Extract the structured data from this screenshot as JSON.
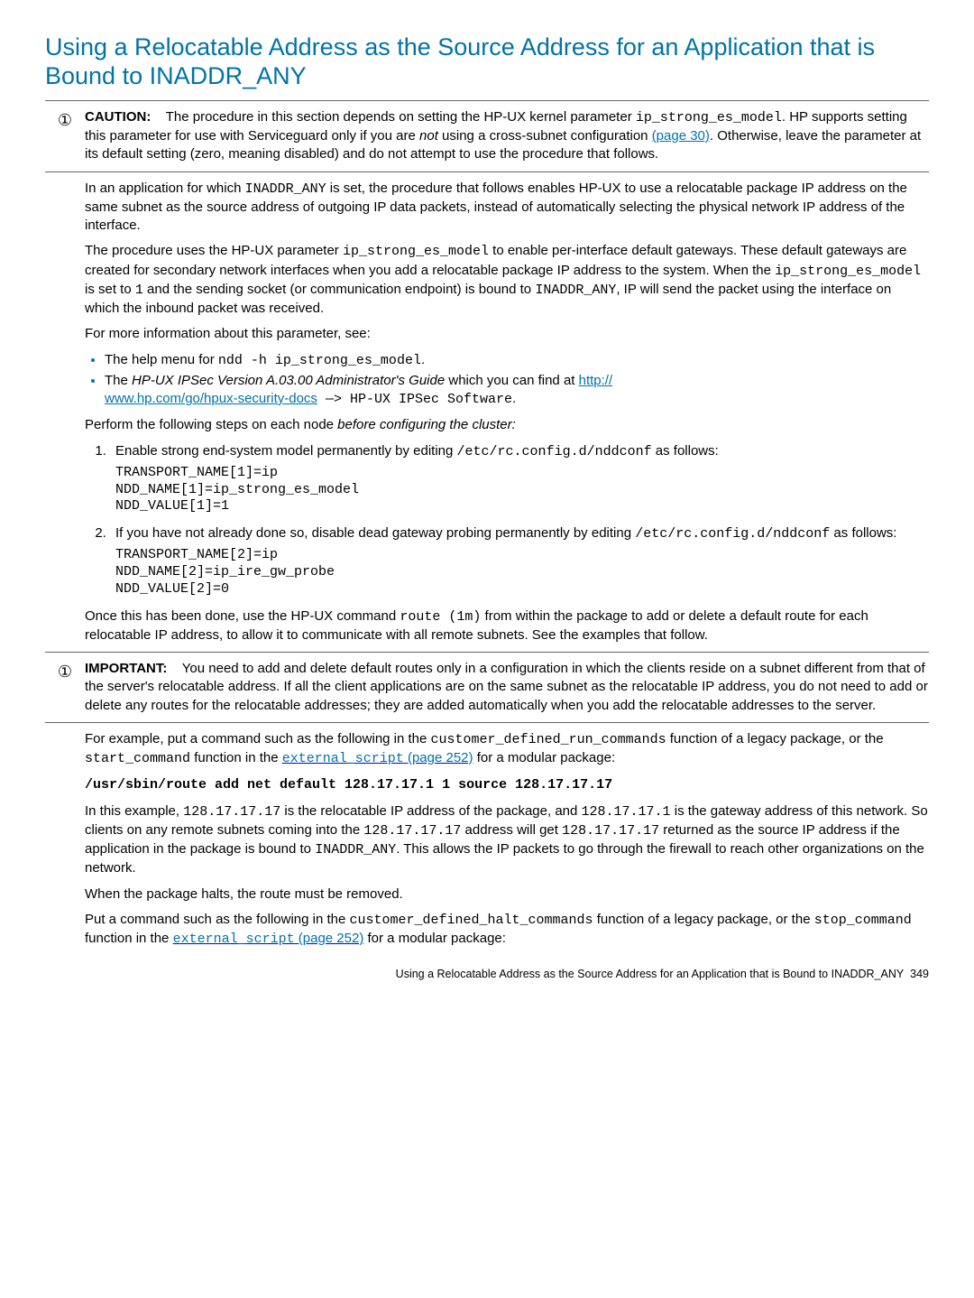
{
  "heading": "Using a Relocatable Address as the Source Address for an Application that is Bound to INADDR_ANY",
  "caution": {
    "icon": "①",
    "label": "CAUTION:",
    "t1": "The procedure in this section depends on setting the HP-UX kernel parameter ",
    "code1": "ip_strong_es_model",
    "t2": ". HP supports setting this parameter for use with Serviceguard only if you are ",
    "t2i": "not",
    "t3": " using a cross-subnet configuration ",
    "link1": "(page 30)",
    "t4": ". Otherwise, leave the parameter at its default setting (zero, meaning disabled) and do not attempt to use the procedure that follows."
  },
  "p1": {
    "a": "In an application for which ",
    "c": "INADDR_ANY",
    "b": " is set, the procedure that follows enables HP-UX to use a relocatable package IP address on the same subnet as the source address of outgoing IP data packets, instead of automatically selecting the physical network IP address of the interface."
  },
  "p2": {
    "a": "The procedure uses the HP-UX parameter ",
    "c1": "ip_strong_es_model",
    "b": " to enable per-interface default gateways. These default gateways are created for secondary network interfaces when you add a relocatable package IP address to the system. When the ",
    "c2": "ip_strong_es_model",
    "c": " is set to ",
    "c3": "1",
    "d": " and the sending socket (or communication endpoint) is bound to ",
    "c4": "INADDR_ANY",
    "e": ", IP will send the packet using the interface on which the inbound packet was received."
  },
  "p3": "For more information about this parameter, see:",
  "bul1_a": "The help menu for ",
  "bul1_c": "ndd -h ip_strong_es_model",
  "bul1_b": ".",
  "bul2_a": "The ",
  "bul2_i": "HP-UX IPSec Version A.03.00 Administrator's Guide",
  "bul2_b": " which you can find at ",
  "bul2_link1": "http://",
  "bul2_link2": "www.hp.com/go/hpux-security-docs",
  "bul2_c": " —> HP-UX IPSec Software",
  "bul2_d": ".",
  "p4_a": "Perform the following steps on each node ",
  "p4_i": "before configuring the cluster:",
  "step1_a": "Enable strong end-system model permanently by editing ",
  "step1_c": "/etc/rc.config.d/nddconf",
  "step1_b": " as follows:",
  "step1_code": "TRANSPORT_NAME[1]=ip\nNDD_NAME[1]=ip_strong_es_model\nNDD_VALUE[1]=1",
  "step2_a": "If you have not already done so, disable dead gateway probing permanently by editing ",
  "step2_c": "/etc/rc.config.d/nddconf",
  "step2_b": " as follows:",
  "step2_code": "TRANSPORT_NAME[2]=ip\nNDD_NAME[2]=ip_ire_gw_probe\nNDD_VALUE[2]=0",
  "p5_a": "Once this has been done, use the HP-UX command ",
  "p5_c": "route (1m)",
  "p5_b": " from within the package to add or delete a default route for each relocatable IP address, to allow it to communicate with all remote subnets. See the examples that follow.",
  "important": {
    "icon": "①",
    "label": "IMPORTANT:",
    "text": "You need to add and delete default routes only in a configuration in which the clients reside on a subnet different from that of the server's relocatable address. If all the client applications are on the same subnet as the relocatable IP address, you do not need to add or delete any routes for the relocatable addresses; they are added automatically when you add the relocatable addresses to the server."
  },
  "p6_a": "For example, put a command such as the following in the ",
  "p6_c1": "customer_defined_run_commands",
  "p6_b": " function of a legacy package, or the ",
  "p6_c2": "start_command",
  "p6_c": " function in the ",
  "p6_link": "external_script",
  "p6_page": " (page 252)",
  "p6_d": " for a modular package:",
  "cmdline": "/usr/sbin/route add net default 128.17.17.1 1 source 128.17.17.17",
  "p7_a": "In this example, ",
  "p7_c1": "128.17.17.17",
  "p7_b": " is the relocatable IP address of the package, and ",
  "p7_c2": "128.17.17.1",
  "p7_c": " is the gateway address of this network. So clients on any remote subnets coming into the ",
  "p7_c3": "128.17.17.17",
  "p7_d": " address will get ",
  "p7_c4": "128.17.17.17",
  "p7_e": " returned as the source IP address if the application in the package is bound to ",
  "p7_c5": "INADDR_ANY",
  "p7_f": ". This allows the IP packets to go through the firewall to reach other organizations on the network.",
  "p8": "When the package halts, the route must be removed.",
  "p9_a": "Put a command such as the following in the ",
  "p9_c1": "customer_defined_halt_commands",
  "p9_b": " function of a legacy package, or the ",
  "p9_c2": "stop_command",
  "p9_c": " function in the ",
  "p9_link": "external_script",
  "p9_page": " (page 252)",
  "p9_d": " for a modular package:",
  "footer_a": "Using a Relocatable Address as the Source Address for an Application that is Bound to INADDR_ANY",
  "footer_b": "349"
}
